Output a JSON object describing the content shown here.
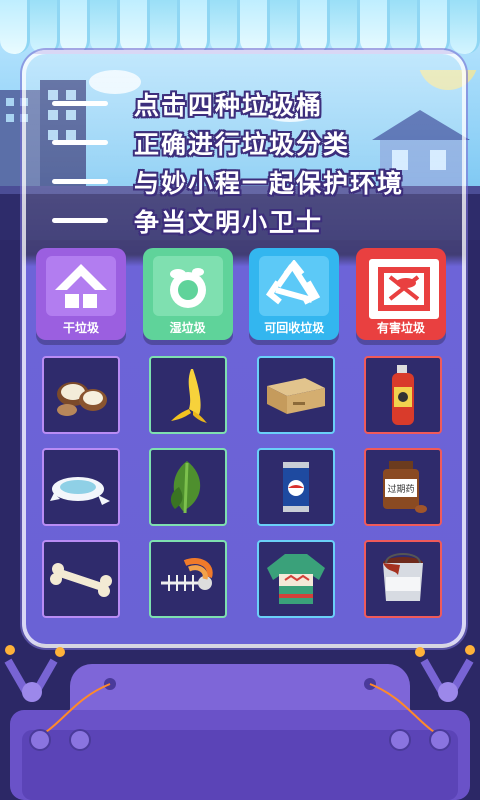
{
  "slogans": [
    "点击四种垃圾桶",
    "正确进行垃圾分类",
    "与妙小程一起保护环境",
    "争当文明小卫士"
  ],
  "bins": [
    {
      "label": "干垃圾",
      "color": "#9b5fe0",
      "icon": "dry-waste-icon"
    },
    {
      "label": "湿垃圾",
      "color": "#5fd39a",
      "icon": "wet-waste-icon"
    },
    {
      "label": "可回收垃圾",
      "color": "#33b6ef",
      "icon": "recycle-icon"
    },
    {
      "label": "有害垃圾",
      "color": "#e94040",
      "icon": "hazardous-icon"
    }
  ],
  "items": [
    [
      "coconut-shell-icon",
      "banana-peel-icon",
      "cardboard-box-icon",
      "insecticide-spray-icon"
    ],
    [
      "broken-plate-icon",
      "vegetable-leaf-icon",
      "soda-can-icon",
      "expired-medicine-icon"
    ],
    [
      "bone-icon",
      "fish-bone-shrimp-icon",
      "sweater-icon",
      "paint-bucket-icon"
    ]
  ],
  "medicine_label": "过期药"
}
